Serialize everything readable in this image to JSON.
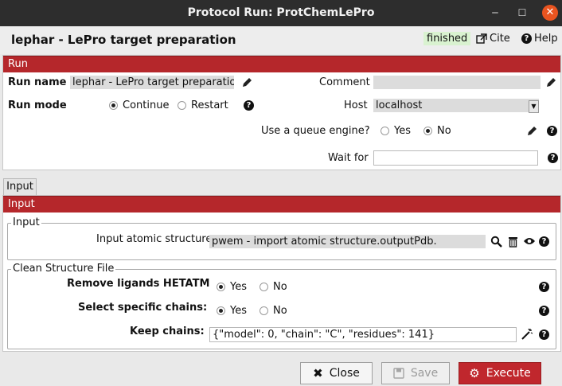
{
  "window": {
    "title": "Protocol Run: ProtChemLePro",
    "minimize": "‒",
    "maximize": "☐",
    "close": "✕"
  },
  "header": {
    "title": "lephar - LePro target preparation",
    "status": "finished",
    "cite": "Cite",
    "help": "Help"
  },
  "run_section": {
    "bar": "Run",
    "run_name_label": "Run name",
    "run_name_value": "lephar - LePro target preparation",
    "comment_label": "Comment",
    "comment_value": "",
    "run_mode_label": "Run mode",
    "run_mode_options": [
      "Continue",
      "Restart"
    ],
    "run_mode_selected": "Continue",
    "host_label": "Host",
    "host_value": "localhost",
    "queue_label": "Use a queue engine?",
    "queue_options": [
      "Yes",
      "No"
    ],
    "queue_selected": "No",
    "wait_for_label": "Wait for",
    "wait_for_value": ""
  },
  "tabs": [
    {
      "label": "Input",
      "active": true
    }
  ],
  "input_section": {
    "bar": "Input",
    "input_group": {
      "title": "Input",
      "atomic_structure_label": "Input atomic structure:",
      "atomic_structure_value": "pwem - import atomic structure.outputPdb."
    },
    "clean_group": {
      "title": "Clean Structure File",
      "remove_ligands_label": "Remove ligands HETATM",
      "remove_ligands_options": [
        "Yes",
        "No"
      ],
      "remove_ligands_selected": "Yes",
      "select_chains_label": "Select specific chains:",
      "select_chains_options": [
        "Yes",
        "No"
      ],
      "select_chains_selected": "Yes",
      "keep_chains_label": "Keep chains:",
      "keep_chains_value": "{\"model\": 0, \"chain\": \"C\", \"residues\": 141}"
    }
  },
  "buttons": {
    "close": "Close",
    "save": "Save",
    "execute": "Execute"
  },
  "colors": {
    "accent_red": "#b5272b",
    "status_bg": "#d9f2d0",
    "ubuntu_orange": "#e95420"
  }
}
